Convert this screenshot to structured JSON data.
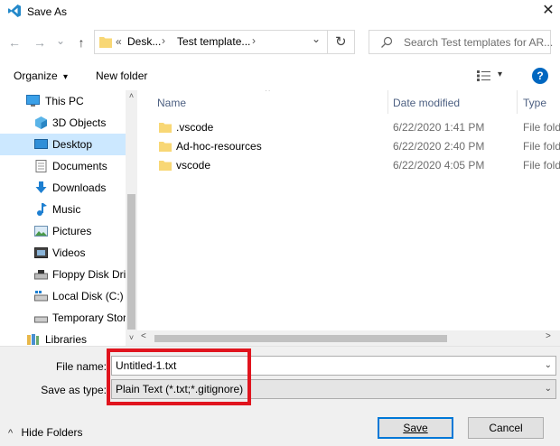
{
  "window": {
    "title": "Save As",
    "close_glyph": "✕"
  },
  "nav": {
    "back_glyph": "←",
    "forward_glyph": "→",
    "recent_glyph": "⌄",
    "up_glyph": "↑",
    "breadcrumb": {
      "overflow": "«",
      "items": [
        "Desk...",
        "Test template..."
      ],
      "separator": "›",
      "dropdown_glyph": "⌄"
    },
    "refresh_glyph": "↻",
    "search_placeholder": "Search Test templates for AR..."
  },
  "toolbar": {
    "organize_label": "Organize",
    "organize_arrow": "▾",
    "new_folder_label": "New folder",
    "view_arrow": "▾",
    "help_glyph": "?"
  },
  "navpane": {
    "items": [
      {
        "label": "This PC",
        "icon": "computer-icon"
      },
      {
        "label": "3D Objects",
        "icon": "cube-icon"
      },
      {
        "label": "Desktop",
        "icon": "desktop-icon",
        "selected": true
      },
      {
        "label": "Documents",
        "icon": "documents-icon"
      },
      {
        "label": "Downloads",
        "icon": "download-icon"
      },
      {
        "label": "Music",
        "icon": "music-icon"
      },
      {
        "label": "Pictures",
        "icon": "pictures-icon"
      },
      {
        "label": "Videos",
        "icon": "videos-icon"
      },
      {
        "label": "Floppy Disk Dri",
        "icon": "floppy-drive-icon"
      },
      {
        "label": "Local Disk (C:)",
        "icon": "local-disk-icon"
      },
      {
        "label": "Temporary Stor",
        "icon": "drive-icon"
      },
      {
        "label": "Libraries",
        "icon": "libraries-icon"
      }
    ],
    "scroll_up": "˄",
    "scroll_down": "˅"
  },
  "filelist": {
    "columns": {
      "name": "Name",
      "date": "Date modified",
      "type": "Type"
    },
    "sort_glyph": "^",
    "rows": [
      {
        "name": ".vscode",
        "date": "6/22/2020 1:41 PM",
        "type": "File folder"
      },
      {
        "name": "Ad-hoc-resources",
        "date": "6/22/2020 2:40 PM",
        "type": "File folder"
      },
      {
        "name": "vscode",
        "date": "6/22/2020 4:05 PM",
        "type": "File folder"
      }
    ],
    "scroll_left": "<",
    "scroll_right": ">"
  },
  "form": {
    "filename_label": "File name:",
    "filename_value": "Untitled-1.txt",
    "savetype_label": "Save as type:",
    "savetype_value": "Plain Text (*.txt;*.gitignore)",
    "dropdown_glyph": "⌄"
  },
  "footer": {
    "hide_folders_glyph": "^",
    "hide_folders_label": "Hide Folders",
    "save_label": "Save",
    "cancel_label": "Cancel"
  },
  "colors": {
    "selection": "#cce8ff",
    "accent": "#0078d7",
    "highlight_box": "#e0141e",
    "folder": "#f8d775"
  }
}
